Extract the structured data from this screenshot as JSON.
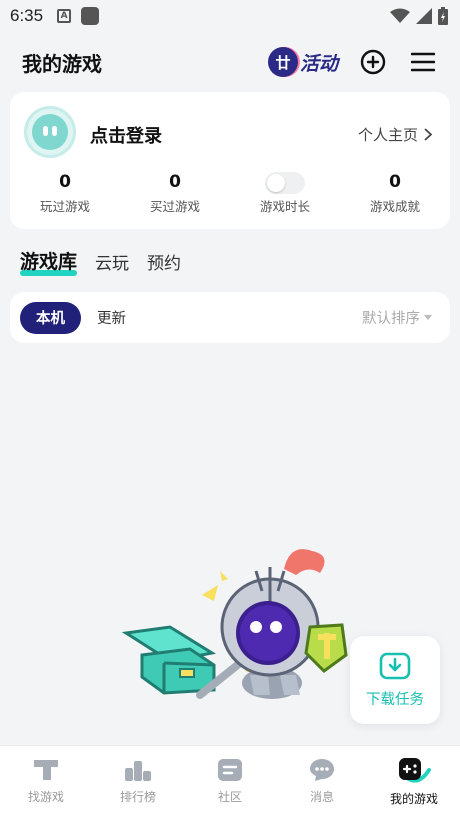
{
  "status_bar": {
    "time": "6:35",
    "indicator_a": "A"
  },
  "header": {
    "title": "我的游戏",
    "event_icon_char": "廿",
    "event_label": "活动"
  },
  "profile": {
    "login_text": "点击登录",
    "homepage_link": "个人主页",
    "stats": [
      {
        "value": "0",
        "label": "玩过游戏"
      },
      {
        "value": "0",
        "label": "买过游戏"
      },
      {
        "value": "",
        "label": "游戏时长",
        "toggle": true
      },
      {
        "value": "0",
        "label": "游戏成就"
      }
    ]
  },
  "tabs": [
    {
      "label": "游戏库",
      "active": true
    },
    {
      "label": "云玩",
      "active": false
    },
    {
      "label": "预约",
      "active": false
    }
  ],
  "filter": {
    "local_label": "本机",
    "update_label": "更新",
    "sort_label": "默认排序"
  },
  "download": {
    "label": "下载任务"
  },
  "bottom_nav": [
    {
      "label": "找游戏",
      "icon": "hammer-icon",
      "active": false
    },
    {
      "label": "排行榜",
      "icon": "podium-icon",
      "active": false
    },
    {
      "label": "社区",
      "icon": "community-icon",
      "active": false
    },
    {
      "label": "消息",
      "icon": "message-icon",
      "active": false
    },
    {
      "label": "我的游戏",
      "icon": "gamepad-icon",
      "active": true
    }
  ],
  "colors": {
    "accent_teal": "#21d3c1",
    "primary_navy": "#22217a",
    "background": "#f3f4f6"
  }
}
